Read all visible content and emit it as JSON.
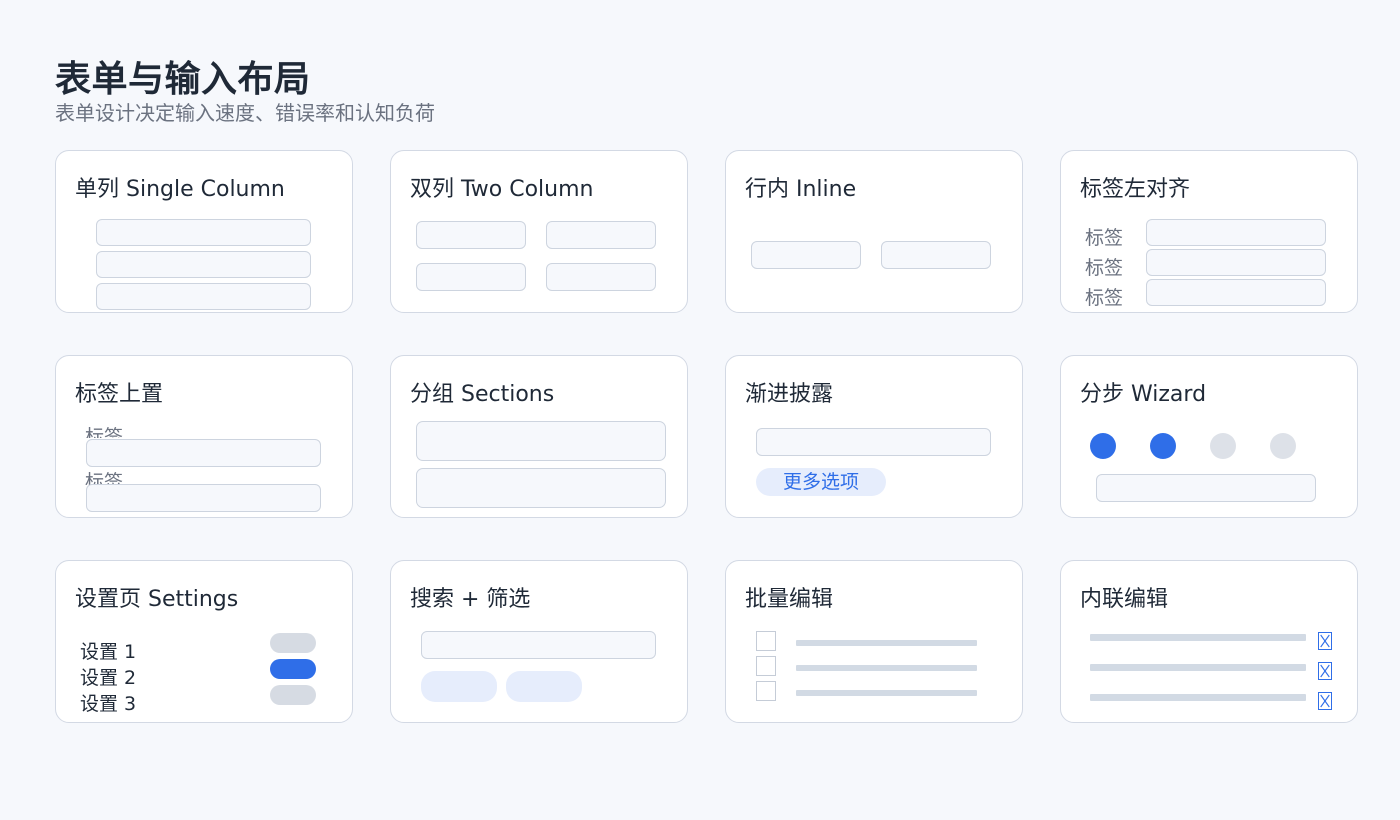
{
  "header": {
    "title": "表单与输入布局",
    "subtitle": "表单设计决定输入速度、错误率和认知负荷"
  },
  "cards": {
    "single_column": {
      "title": "单列 Single Column"
    },
    "two_column": {
      "title": "双列 Two Column"
    },
    "inline": {
      "title": "行内 Inline"
    },
    "label_left": {
      "title": "标签左对齐",
      "labels": [
        "标签",
        "标签",
        "标签"
      ]
    },
    "label_top": {
      "title": "标签上置",
      "labels": [
        "标签",
        "标签"
      ]
    },
    "sections": {
      "title": "分组 Sections"
    },
    "progressive": {
      "title": "渐进披露",
      "button": "更多选项"
    },
    "wizard": {
      "title": "分步 Wizard",
      "steps_done": 2,
      "steps_total": 4
    },
    "settings": {
      "title": "设置页 Settings",
      "items": [
        {
          "label": "设置 1",
          "on": false
        },
        {
          "label": "设置 2",
          "on": true
        },
        {
          "label": "设置 3",
          "on": false
        }
      ]
    },
    "search_filter": {
      "title": "搜索 + 筛选"
    },
    "batch_edit": {
      "title": "批量编辑"
    },
    "inline_edit": {
      "title": "内联编辑"
    }
  },
  "colors": {
    "accent": "#2f6ee8",
    "accent_soft": "#e6edfc",
    "card_border": "#d3d9e4",
    "background": "#f6f8fc"
  },
  "icons": [
    "checkbox-icon",
    "edit-icon",
    "toggle-icon",
    "step-dot-icon"
  ]
}
